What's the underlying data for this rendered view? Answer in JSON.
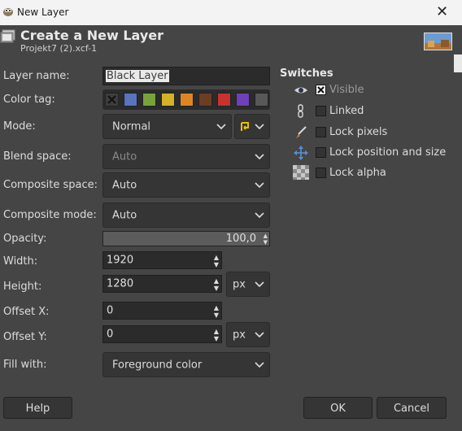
{
  "window": {
    "title": "New Layer",
    "close_glyph": "✕"
  },
  "header": {
    "title": "Create a New Layer",
    "subtitle": "Projekt7 (2).xcf-1"
  },
  "form": {
    "layer_name": {
      "label": "Layer name:",
      "value": "Black Layer"
    },
    "color_tag": {
      "label": "Color tag:",
      "swatches": [
        "#3d3d3d",
        "#5a74bc",
        "#79a33a",
        "#d4b127",
        "#de8523",
        "#6b3e22",
        "#c5332f",
        "#7040b8",
        "#585858"
      ]
    },
    "mode": {
      "label": "Mode:",
      "value": "Normal"
    },
    "blend_space": {
      "label": "Blend space:",
      "value": "Auto"
    },
    "composite_space": {
      "label": "Composite space:",
      "value": "Auto"
    },
    "composite_mode": {
      "label": "Composite mode:",
      "value": "Auto"
    },
    "opacity": {
      "label": "Opacity:",
      "value": "100,0",
      "fraction": 1.0
    },
    "width": {
      "label": "Width:",
      "value": "1920"
    },
    "height": {
      "label": "Height:",
      "value": "1280"
    },
    "size_unit": "px",
    "offset_x": {
      "label": "Offset X:",
      "value": "0"
    },
    "offset_y": {
      "label": "Offset Y:",
      "value": "0"
    },
    "offset_unit": "px",
    "fill_with": {
      "label": "Fill with:",
      "value": "Foreground color"
    }
  },
  "switches": {
    "title": "Switches",
    "items": [
      {
        "label": "Visible",
        "checked": true,
        "icon": "eye-icon"
      },
      {
        "label": "Linked",
        "checked": false,
        "icon": "chain-icon"
      },
      {
        "label": "Lock pixels",
        "checked": false,
        "icon": "brush-icon"
      },
      {
        "label": "Lock position and size",
        "checked": false,
        "icon": "move-icon"
      },
      {
        "label": "Lock alpha",
        "checked": false,
        "icon": "checkerboard-icon"
      }
    ]
  },
  "buttons": {
    "help": "Help",
    "ok": "OK",
    "cancel": "Cancel"
  }
}
